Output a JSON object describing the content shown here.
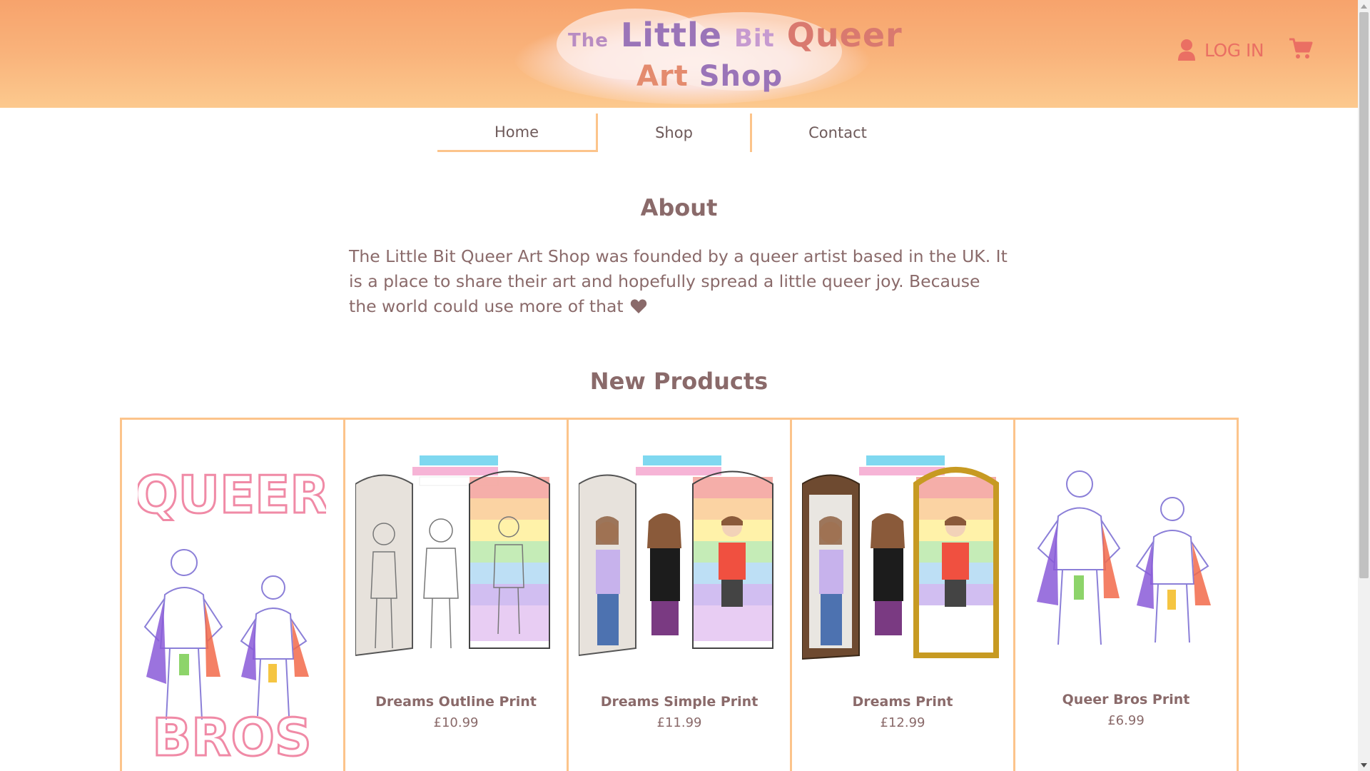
{
  "colors": {
    "header_gradient_top": "#f7a36c",
    "header_gradient_bottom": "#fcc98e",
    "accent_border": "#fcc48b",
    "text": "#8a6a6a",
    "login": "#ea6f63"
  },
  "header": {
    "logo": {
      "the": "The",
      "little": "Little",
      "bit": "Bit",
      "queer": "Queer",
      "art": "Art",
      "shop": "Shop"
    },
    "login_label": "LOG IN",
    "user_icon": "user-icon",
    "cart_icon": "shopping-cart-icon"
  },
  "nav": {
    "items": [
      {
        "label": "Home",
        "active": true
      },
      {
        "label": "Shop",
        "active": false
      },
      {
        "label": "Contact",
        "active": false
      }
    ]
  },
  "about": {
    "title": "About",
    "text": "The Little Bit Queer Art Shop was founded by a queer artist based in the UK. It is a place to share their art and hopefully spread a little queer joy. Because the world could use more of that",
    "heart_icon": "heart-icon"
  },
  "products": {
    "title": "New Products",
    "items": [
      {
        "name": "",
        "price": "",
        "image": "queer-bros-poster"
      },
      {
        "name": "Dreams Outline Print",
        "price": "£10.99",
        "image": "dreams-outline-print"
      },
      {
        "name": "Dreams Simple Print",
        "price": "£11.99",
        "image": "dreams-simple-print"
      },
      {
        "name": "Dreams Print",
        "price": "£12.99",
        "image": "dreams-print"
      },
      {
        "name": "Queer Bros Print",
        "price": "£6.99",
        "image": "queer-bros-print"
      }
    ]
  }
}
